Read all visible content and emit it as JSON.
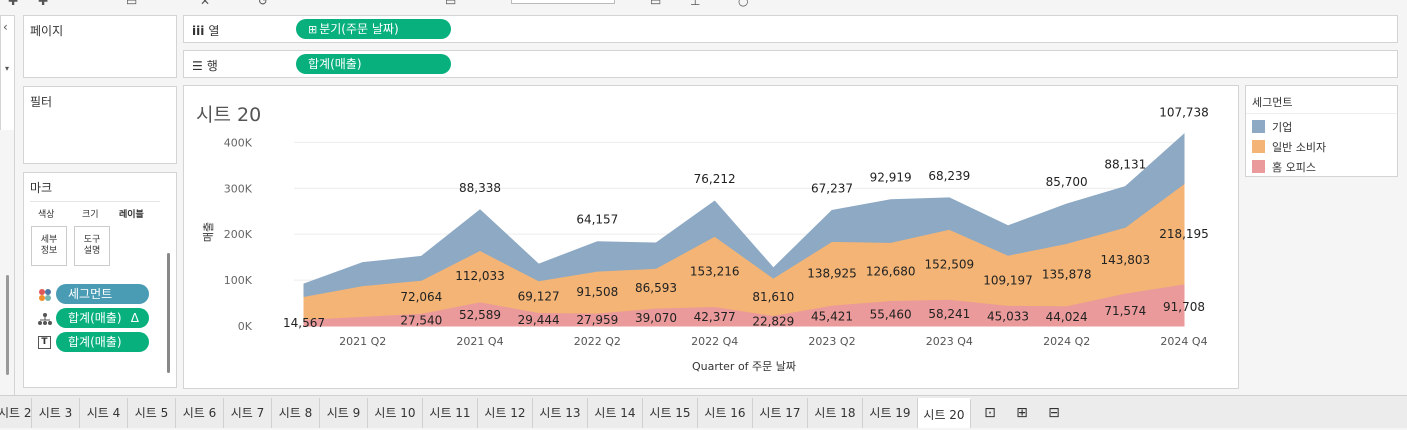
{
  "shelves": {
    "pages_label": "페이지",
    "columns_label": "열",
    "rows_label": "행",
    "filters_label": "필터",
    "marks_label": "마크",
    "columns_pill": "분기(주문 날짜)",
    "rows_pill": "합계(매출)"
  },
  "marks": {
    "color_label": "색상",
    "size_label": "크기",
    "label_label": "레이블",
    "detail_label": "세부\n정보",
    "tooltip_label": "도구\n설명",
    "pills": [
      {
        "label": "세그먼트",
        "icon": "color-dots-icon"
      },
      {
        "label": "합계(매출)",
        "icon": "detail-tree-icon"
      },
      {
        "label": "합계(매출)",
        "icon": "text-label-icon"
      }
    ],
    "delta_symbol": "Δ"
  },
  "legend": {
    "title": "세그먼트",
    "items": [
      {
        "label": "기업",
        "color": "#8da9c4"
      },
      {
        "label": "일반 소비자",
        "color": "#f3b475"
      },
      {
        "label": "홈 오피스",
        "color": "#ea9a9a"
      }
    ]
  },
  "sheet_title": "시트 20",
  "chart_data": {
    "type": "area",
    "stacked": true,
    "x": [
      "2021 Q1",
      "2021 Q2",
      "2021 Q3",
      "2021 Q4",
      "2022 Q1",
      "2022 Q2",
      "2022 Q3",
      "2022 Q4",
      "2023 Q1",
      "2023 Q2",
      "2023 Q3",
      "2023 Q4",
      "2024 Q1",
      "2024 Q2",
      "2024 Q3",
      "2024 Q4"
    ],
    "x_tick_labels": [
      "2021 Q2",
      "2021 Q4",
      "2022 Q2",
      "2022 Q4",
      "2023 Q2",
      "2023 Q4",
      "2024 Q2",
      "2024 Q4"
    ],
    "xlabel": "Quarter of 주문 날짜",
    "ylabel": "매출",
    "y_ticks": [
      "0K",
      "100K",
      "200K",
      "300K",
      "400K"
    ],
    "ylim": [
      0,
      440000
    ],
    "series": [
      {
        "name": "홈 오피스",
        "values": [
          14567,
          21000,
          27540,
          52589,
          29444,
          27959,
          39070,
          42377,
          22829,
          45421,
          55460,
          58241,
          45033,
          44024,
          71574,
          91708
        ]
      },
      {
        "name": "일반 소비자",
        "values": [
          50000,
          67000,
          72064,
          112033,
          69127,
          91508,
          86593,
          153216,
          81610,
          138925,
          126680,
          152509,
          109197,
          135878,
          143803,
          218195
        ]
      },
      {
        "name": "기업",
        "values": [
          27000,
          50000,
          52000,
          88338,
          36000,
          64157,
          55000,
          76212,
          22000,
          67237,
          92919,
          68239,
          64000,
          85700,
          88131,
          107738
        ]
      }
    ],
    "data_labels": [
      {
        "series": "홈 오피스",
        "values": [
          "14,567",
          "",
          "27,540",
          "52,589",
          "29,444",
          "27,959",
          "39,070",
          "42,377",
          "22,829",
          "45,421",
          "55,460",
          "58,241",
          "45,033",
          "44,024",
          "71,574",
          "91,708"
        ]
      },
      {
        "series": "일반 소비자",
        "values": [
          "",
          "",
          "72,064",
          "112,033",
          "69,127",
          "91,508",
          "86,593",
          "153,216",
          "81,610",
          "138,925",
          "126,680",
          "152,509",
          "109,197",
          "135,878",
          "143,803",
          "218,195"
        ]
      },
      {
        "series": "기업",
        "values": [
          "",
          "",
          "",
          "88,338",
          "",
          "64,157",
          "",
          "76,212",
          "",
          "67,237",
          "92,919",
          "68,239",
          "",
          "85,700",
          "88,131",
          "107,738"
        ]
      }
    ],
    "grid": "horizontal"
  },
  "tabs": [
    "시트 2",
    "시트 3",
    "시트 4",
    "시트 5",
    "시트 6",
    "시트 7",
    "시트 8",
    "시트 9",
    "시트 10",
    "시트 11",
    "시트 12",
    "시트 13",
    "시트 14",
    "시트 15",
    "시트 16",
    "시트 17",
    "시트 18",
    "시트 19",
    "시트 20"
  ],
  "active_tab": "시트 20",
  "tab_actions": [
    "new-worksheet-icon",
    "new-dashboard-icon",
    "new-story-icon"
  ]
}
